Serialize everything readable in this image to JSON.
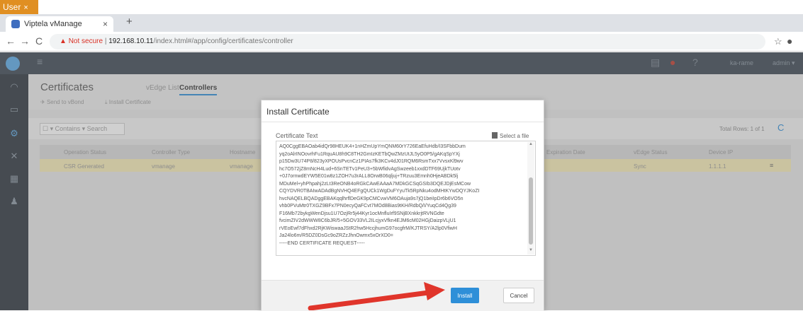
{
  "user_tab": {
    "label": "User",
    "close": "×"
  },
  "browser": {
    "tab_title": "Viptela vManage",
    "tab_close": "×",
    "new_tab": "+",
    "back": "←",
    "forward": "→",
    "reload": "C",
    "not_secure": "Not secure",
    "host": "192.168.10.11",
    "path": "/index.html#/app/config/certificates/controller"
  },
  "header": {
    "menu_icon": "≡",
    "username": "ka-rame",
    "user_menu": "admin ▾"
  },
  "page": {
    "title": "Certificates",
    "tabs": [
      {
        "label": "vEdge List"
      },
      {
        "label": "Controllers"
      }
    ],
    "actions": {
      "send_to_vbond": "Send to vBond",
      "install_certificate": "Install Certificate"
    },
    "filter": {
      "label": "Contains",
      "placeholder": "Search"
    },
    "total_rows": "Total Rows: 1 of 1",
    "columns": [
      "Operation Status",
      "Controller Type",
      "Hostname",
      "Expiration Date",
      "vEdge Status",
      "Device IP"
    ],
    "rows": [
      {
        "operation_status": "CSR Generated",
        "controller_type": "vmanage",
        "hostname": "vmanage",
        "vedge_status": "Sync",
        "device_ip": "1.1.1.1"
      }
    ]
  },
  "modal": {
    "title": "Install Certificate",
    "cert_label": "Certificate Text",
    "select_file": "Select a file",
    "cert_lines": [
      "AQ0CggEBAOab4idQr98HEUK4+1nHZmUpYmQNM60rY726EaEfuHdb/I3SFbbDum",
      "yq2oAlrINOovrhFu1RquAU8h9C8TH2GmIzKETbQwZMzUtJL5yO0P5/gAKqSpYXj",
      "p15Dw3U74P8/823yXPOUsPvcnCz1PIAs7fk3KCv4dJ01RQM6RsmTxx7VvsxKl9wv",
      "hc7O572jZ8mNcH4Lud+6SnTETv1PeU3+5bWfidvAgSwzeeb1xxdDTF69UjkTUotv",
      "+0J7ornwdEYW5E01w8z1ZOH7u3rALL8OrwB06qljuj+TRzuu3Emnh0HjeABDk5lj",
      "MDuMel+yhPhpahj2zLt3ReONB4oRGkCAwEAAaA7MDkGCSqGSIb3DQEJDjEsMCow",
      "CQYDVR0TBAIwADAdBgNVHQ4EFgQUCk1WgDuFYyuTk5RpNku4odMHtKYwDQYJKoZI",
      "hvcNAQELBQADggEBAKqqlhrflDeGK9pCMCvwVM6OAuja9s7jQ1beiIpDr6b6VO5n",
      "vhb0PVuMtr0TXGZ9BFx7PN0ecyQaFCvt7MOd8Bias9tKH/RdbQ/I/YuqCd4Qg39",
      "F16Mb72bykgWenDjsu1U7OzjRr5j44Kyr1ocMnfluIrf9SNjBXnkkrjtRVNGdte",
      "fvcimZIV2dWWW8C6bJR/5+5GOV33VL2ILcjyxVfkn4EJM6cM02HGjDaizpVLjU1",
      "rVEoEwf7dFhxd2RjKWiswaaJStR2hw5HccjhumG97ocgfrM/KJTRSY/A2lp0VfiwH",
      "Ja24lo6m/R5DZ0DsGc9oZRZzJhnOwmx5xOrXD0=",
      "-----END CERTIFICATE REQUEST-----"
    ],
    "install_label": "Install",
    "cancel_label": "Cancel"
  }
}
